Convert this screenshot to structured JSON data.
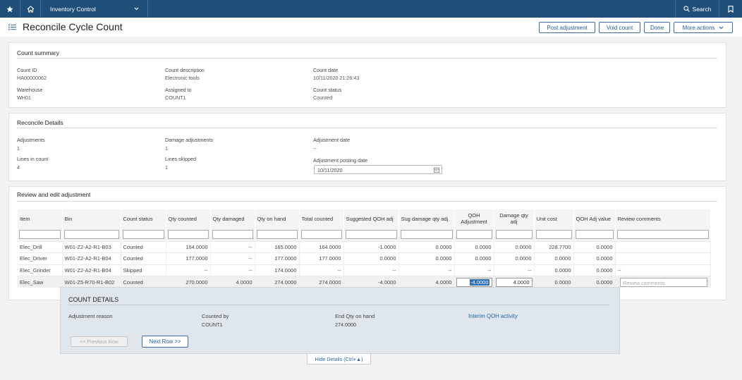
{
  "topbar": {
    "app_name": "Inventory Control",
    "search_label": "Search",
    "icons": [
      "star-icon",
      "home-icon",
      "chevron-down-icon",
      "search-icon",
      "bookmark-icon"
    ]
  },
  "header": {
    "title": "Reconcile Cycle Count",
    "actions": {
      "post": "Post adjustment",
      "void": "Void count",
      "done": "Done",
      "more": "More actions"
    }
  },
  "count_summary": {
    "title": "Count summary",
    "count_id_label": "Count ID",
    "count_id": "HA00000062",
    "description_label": "Count description",
    "description": "Electronic tools",
    "count_date_label": "Count date",
    "count_date": "10/11/2020 21:26:43",
    "warehouse_label": "Warehouse",
    "warehouse": "WH01",
    "assigned_label": "Assigned to",
    "assigned": "COUNT1",
    "status_label": "Count status",
    "status": "Counted"
  },
  "reconcile": {
    "title": "Reconcile Details",
    "adjustments_label": "Adjustments",
    "adjustments": "1",
    "damage_label": "Damage adjustments",
    "damage": "1",
    "adj_date_label": "Adjustment date",
    "adj_date": "--",
    "lines_label": "Lines in count",
    "lines": "4",
    "skipped_label": "Lines skipped",
    "skipped": "1",
    "posting_label": "Adjustment posting date",
    "posting_date": "10/11/2020"
  },
  "review": {
    "title": "Review and edit adjustment",
    "columns": {
      "item": "Item",
      "bin": "Bin",
      "status": "Count status",
      "qty_counted": "Qty counted",
      "qty_damaged": "Qty damaged",
      "qty_on_hand": "Qty on hand",
      "total_counted": "Total counted",
      "sugg_qoh": "Suggested QOH adj",
      "sug_damage": "Sug damage qty adj",
      "qoh_adj_1": "QOH",
      "qoh_adj_2": "Adjustment",
      "damage_adj_1": "Damage qty",
      "damage_adj_2": "adj",
      "unit_cost": "Unit cost",
      "qoh_value": "QOH Adj value",
      "comments": "Review comments"
    },
    "rows": [
      {
        "item": "Elec_Drill",
        "bin": "W01-Z2-A2-R1-B03",
        "status": "Counted",
        "qty_counted": "164.0000",
        "qty_damaged": "--",
        "qty_on_hand": "165.0000",
        "total_counted": "164.0000",
        "sugg_qoh": "-1.0000",
        "sug_damage": "0.0000",
        "qoh_adj": "0.0000",
        "damage_adj": "0.0000",
        "unit_cost": "228.7700",
        "qoh_value": "0.0000",
        "comments": ""
      },
      {
        "item": "Elec_Driver",
        "bin": "W01-Z2-A2-R1-B04",
        "status": "Counted",
        "qty_counted": "177.0000",
        "qty_damaged": "--",
        "qty_on_hand": "177.0000",
        "total_counted": "177.0000",
        "sugg_qoh": "0.0000",
        "sug_damage": "0.0000",
        "qoh_adj": "0.0000",
        "damage_adj": "0.0000",
        "unit_cost": "0.0000",
        "qoh_value": "0.0000",
        "comments": ""
      },
      {
        "item": "Elec_Grinder",
        "bin": "W01-Z2-A2-R1-B04",
        "status": "Skipped",
        "qty_counted": "--",
        "qty_damaged": "--",
        "qty_on_hand": "174.0000",
        "total_counted": "--",
        "sugg_qoh": "--",
        "sug_damage": "--",
        "qoh_adj": "--",
        "damage_adj": "--",
        "unit_cost": "0.0000",
        "qoh_value": "0.0000",
        "comments": "--"
      },
      {
        "item": "Elec_Saw",
        "bin": "W01-Z5-R70-R1-B02",
        "status": "Counted",
        "qty_counted": "270.0000",
        "qty_damaged": "4.0000",
        "qty_on_hand": "274.0000",
        "total_counted": "274.0000",
        "sugg_qoh": "-4.0000",
        "sug_damage": "4.0000",
        "qoh_adj": "-4.0000",
        "damage_adj": "4.0000",
        "unit_cost": "0.0000",
        "qoh_value": "0.0000",
        "comments": ""
      }
    ],
    "comments_placeholder": "Review comments"
  },
  "details": {
    "title": "COUNT DETAILS",
    "reason_label": "Adjustment reason",
    "counted_by_label": "Counted by",
    "counted_by": "COUNT1",
    "end_qty_label": "End Qty on hand",
    "end_qty": "274.0000",
    "link": "Interim QOH activity",
    "prev": "<< Previous Row",
    "next": "Next Row >>",
    "hide": "Hide Details (Ctrl+▲)"
  }
}
